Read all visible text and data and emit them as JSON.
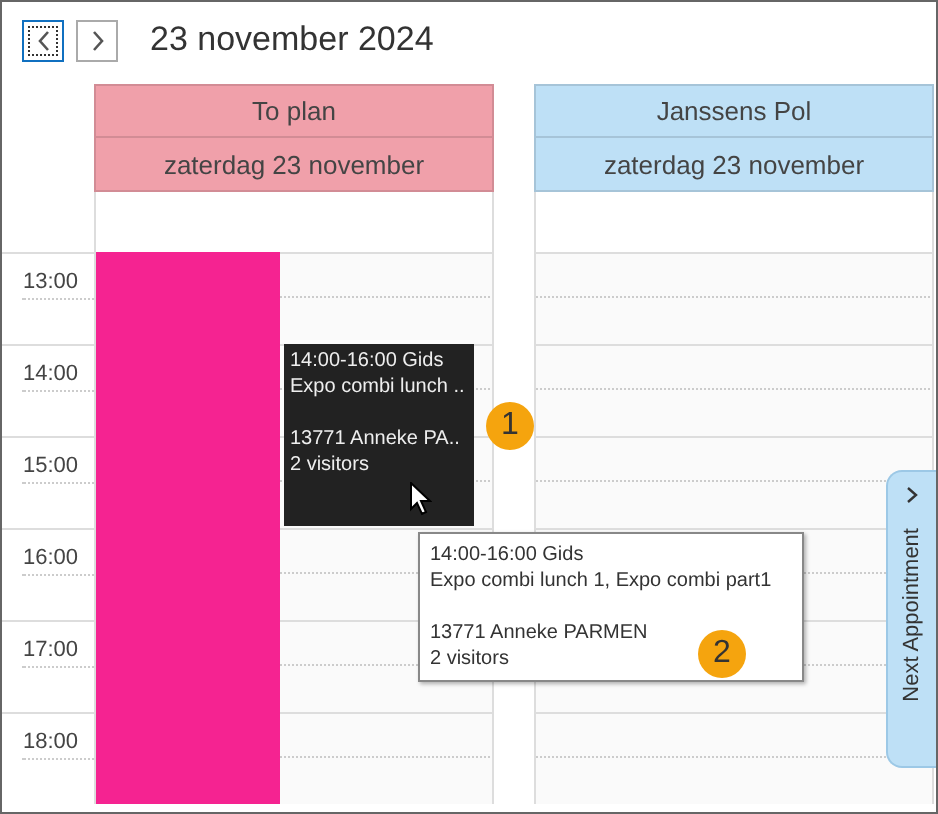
{
  "header": {
    "title": "23 november 2024"
  },
  "time_slots": [
    "13:00",
    "14:00",
    "15:00",
    "16:00",
    "17:00",
    "18:00"
  ],
  "resources": [
    {
      "name": "To plan",
      "date": "zaterdag 23 november",
      "color": "#f0a0aa",
      "blocked": true
    },
    {
      "name": "Janssens Pol",
      "date": "zaterdag 23 november",
      "color": "#bee0f6",
      "blocked": false
    }
  ],
  "appointment": {
    "paragraphs": [
      [
        "14:00-16:00 Gids",
        "Expo combi lunch .."
      ],
      [
        "13771 Anneke PA..",
        "2 visitors"
      ]
    ]
  },
  "tooltip": {
    "paragraphs": [
      [
        "14:00-16:00 Gids",
        "Expo combi lunch 1, Expo combi part1"
      ],
      [
        "13771 Anneke PARMEN",
        "2 visitors"
      ]
    ]
  },
  "callouts": [
    "1",
    "2"
  ],
  "side_tab": {
    "label": "Next Appointment"
  }
}
